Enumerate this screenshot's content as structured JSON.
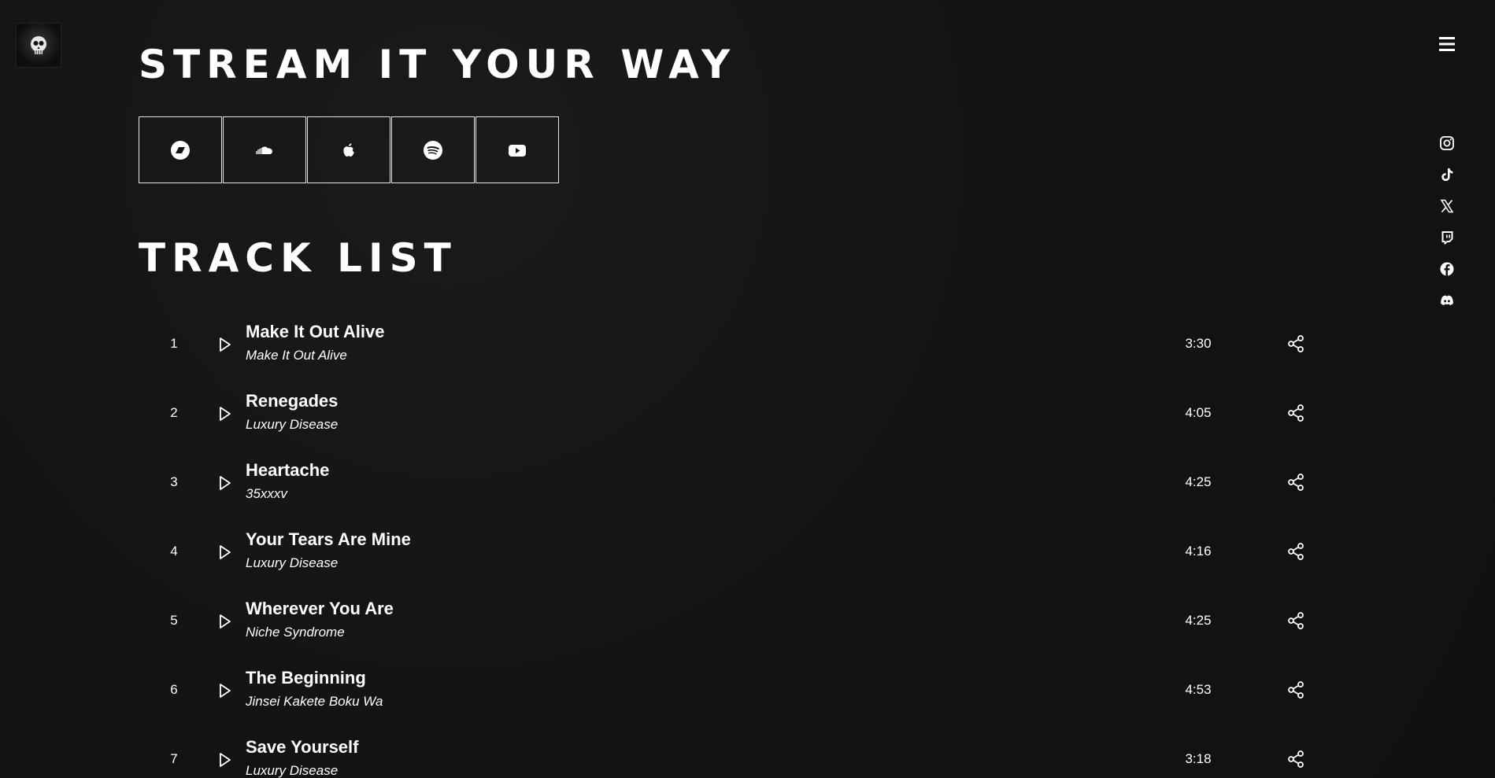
{
  "header": {
    "logo_icon": "band-logo-skull",
    "menu_icon": "hamburger-menu-icon"
  },
  "stream": {
    "heading": "STREAM IT YOUR WAY",
    "platforms": [
      {
        "name": "Bandcamp",
        "icon": "bandcamp-icon"
      },
      {
        "name": "SoundCloud",
        "icon": "soundcloud-icon"
      },
      {
        "name": "Apple Music",
        "icon": "apple-icon"
      },
      {
        "name": "Spotify",
        "icon": "spotify-icon"
      },
      {
        "name": "YouTube",
        "icon": "youtube-icon"
      }
    ]
  },
  "social": {
    "items": [
      {
        "name": "Instagram",
        "icon": "instagram-icon"
      },
      {
        "name": "TikTok",
        "icon": "tiktok-icon"
      },
      {
        "name": "X",
        "icon": "x-icon"
      },
      {
        "name": "Twitch",
        "icon": "twitch-icon"
      },
      {
        "name": "Facebook",
        "icon": "facebook-icon"
      },
      {
        "name": "Discord",
        "icon": "discord-icon"
      }
    ]
  },
  "tracklist": {
    "heading": "TRACK LIST",
    "tracks": [
      {
        "number": "1",
        "title": "Make It Out Alive",
        "album": "Make It Out Alive",
        "duration": "3:30"
      },
      {
        "number": "2",
        "title": "Renegades",
        "album": "Luxury Disease",
        "duration": "4:05"
      },
      {
        "number": "3",
        "title": "Heartache",
        "album": "35xxxv",
        "duration": "4:25"
      },
      {
        "number": "4",
        "title": "Your Tears Are Mine",
        "album": "Luxury Disease",
        "duration": "4:16"
      },
      {
        "number": "5",
        "title": "Wherever You Are",
        "album": "Niche Syndrome",
        "duration": "4:25"
      },
      {
        "number": "6",
        "title": "The Beginning",
        "album": "Jinsei Kakete Boku Wa",
        "duration": "4:53"
      },
      {
        "number": "7",
        "title": "Save Yourself",
        "album": "Luxury Disease",
        "duration": "3:18"
      }
    ]
  },
  "colors": {
    "background": "#141414",
    "text": "#ffffff",
    "border": "#e6e6e6"
  }
}
